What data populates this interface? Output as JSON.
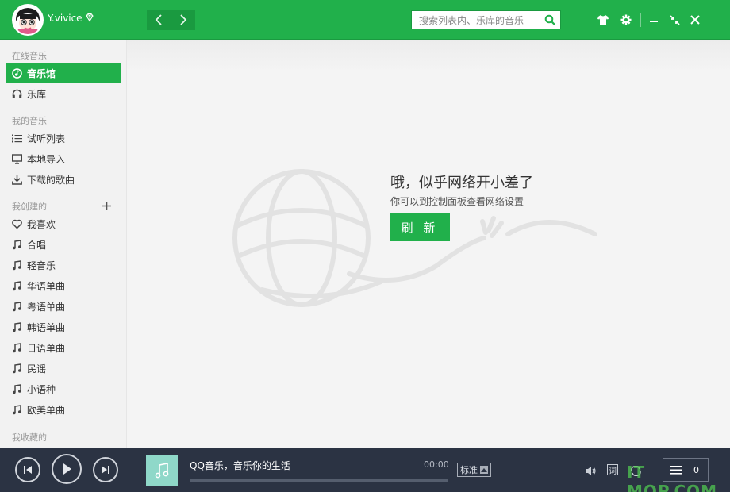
{
  "header": {
    "username": "Y.vivice",
    "search_placeholder": "搜索列表内、乐库的音乐"
  },
  "sidebar": {
    "sections": {
      "online": "在线音乐",
      "my_music": "我的音乐",
      "created": "我创建的",
      "collected": "我收藏的"
    },
    "online_items": [
      {
        "label": "音乐馆",
        "icon": "music-hall-icon",
        "active": true
      },
      {
        "label": "乐库",
        "icon": "headphones-icon",
        "active": false
      }
    ],
    "my_music_items": [
      {
        "label": "试听列表",
        "icon": "list-icon"
      },
      {
        "label": "本地导入",
        "icon": "monitor-icon"
      },
      {
        "label": "下载的歌曲",
        "icon": "download-icon"
      }
    ],
    "created_items": [
      {
        "label": "我喜欢",
        "icon": "heart-icon"
      },
      {
        "label": "合唱",
        "icon": "music-note-icon"
      },
      {
        "label": "轻音乐",
        "icon": "music-note-icon"
      },
      {
        "label": "华语单曲",
        "icon": "music-note-icon"
      },
      {
        "label": "粤语单曲",
        "icon": "music-note-icon"
      },
      {
        "label": "韩语单曲",
        "icon": "music-note-icon"
      },
      {
        "label": "日语单曲",
        "icon": "music-note-icon"
      },
      {
        "label": "民谣",
        "icon": "music-note-icon"
      },
      {
        "label": "小语种",
        "icon": "music-note-icon"
      },
      {
        "label": "欧美单曲",
        "icon": "music-note-icon"
      }
    ]
  },
  "main": {
    "error_title": "哦，似乎网络开小差了",
    "error_subtitle": "你可以到控制面板查看网络设置",
    "refresh_label": "刷 新"
  },
  "player": {
    "song_title": "QQ音乐，音乐你的生活",
    "time": "00:00",
    "quality": "标准",
    "lyrics_label": "词",
    "playlist_count": "0",
    "progress": 0
  },
  "watermark": "IT MOP.COM",
  "colors": {
    "brand_green": "#21b04b",
    "player_bg": "#2b3343",
    "sidebar_bg": "#f2f2f2"
  }
}
